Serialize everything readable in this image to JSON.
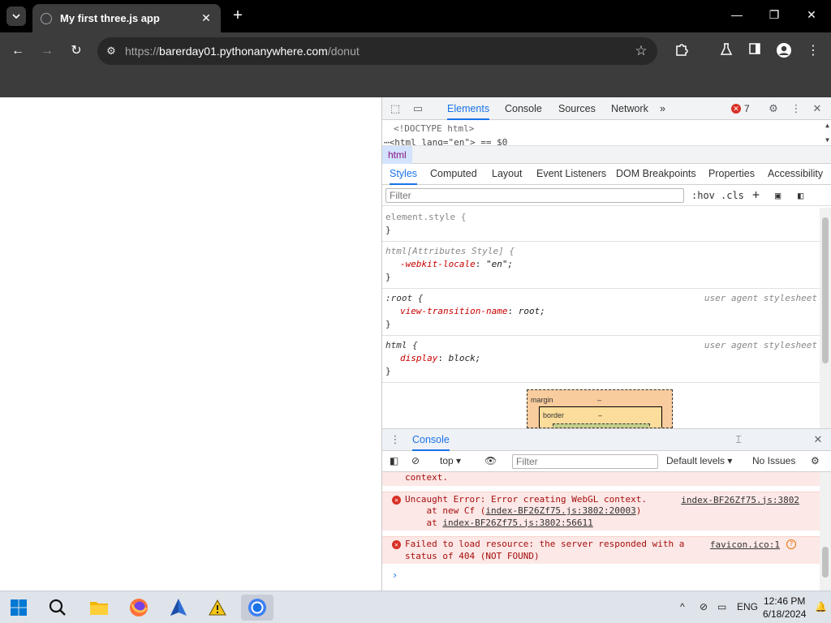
{
  "browser": {
    "tab_title": "My first three.js app",
    "url_scheme": "https://",
    "url_host": "barerday01.pythonanywhere.com",
    "url_path": "/donut",
    "icons": {
      "tab_list": "chevron-down-icon",
      "new_tab": "plus-icon",
      "back": "back-arrow-icon",
      "forward": "forward-arrow-icon",
      "reload": "reload-icon",
      "bookmark": "star-icon",
      "extensions": "puzzle-icon",
      "labs": "flask-icon",
      "side_panel": "side-panel-icon",
      "profile": "profile-icon",
      "menu": "kebab-menu-icon"
    }
  },
  "devtools": {
    "tabs": [
      "Elements",
      "Console",
      "Sources",
      "Network"
    ],
    "more_tabs": "»",
    "error_count": "7",
    "dom": {
      "doctype": "<!DOCTYPE html>",
      "html_node": "⋯<html lang=\"en\"> == $0"
    },
    "breadcrumb": "html",
    "subtabs": [
      "Styles",
      "Computed",
      "Layout",
      "Event Listeners",
      "DOM Breakpoints",
      "Properties",
      "Accessibility"
    ],
    "styles_filter_placeholder": "Filter",
    "hov": ":hov",
    "cls": ".cls",
    "rules": {
      "element_style": {
        "selector": "element.style {",
        "close": "}"
      },
      "attr_style": {
        "selector": "html[Attributes Style] {",
        "prop": "-webkit-locale",
        "value": "\"en\";",
        "close": "}"
      },
      "root": {
        "selector": ":root {",
        "origin": "user agent stylesheet",
        "prop": "view-transition-name",
        "value": "root;",
        "close": "}"
      },
      "html": {
        "selector": "html {",
        "origin": "user agent stylesheet",
        "prop": "display",
        "value": "block;",
        "close": "}"
      }
    },
    "boxmodel": {
      "margin_label": "margin",
      "margin_value": "–",
      "border_label": "border",
      "border_value": "–"
    },
    "drawer_tab": "Console",
    "console": {
      "context": "top",
      "filter_placeholder": "Filter",
      "levels": "Default levels ▾",
      "issues": "No Issues",
      "messages": {
        "cut_line": "context.",
        "m1_text": "Uncaught Error: Error creating WebGL context.",
        "m1_src": "index-BF26Zf75.js:3802",
        "m1_l2_prefix": "    at new Cf (",
        "m1_l2_link": "index-BF26Zf75.js:3802:20003",
        "m1_l2_suffix": ")",
        "m1_l3_prefix": "    at ",
        "m1_l3_link": "index-BF26Zf75.js:3802:56611",
        "m2_line1": "Failed to load resource: the server responded with a",
        "m2_line2": "status of 404 (NOT FOUND)",
        "m2_src": "favicon.ico:1"
      },
      "prompt": "›"
    }
  },
  "taskbar": {
    "apps": [
      "windows-start-icon",
      "search-icon",
      "file-explorer-icon",
      "firefox-icon",
      "app-icon",
      "warning-app-icon",
      "chrome-icon"
    ],
    "language": "ENG",
    "time": "12:46 PM",
    "date": "6/18/2024"
  }
}
